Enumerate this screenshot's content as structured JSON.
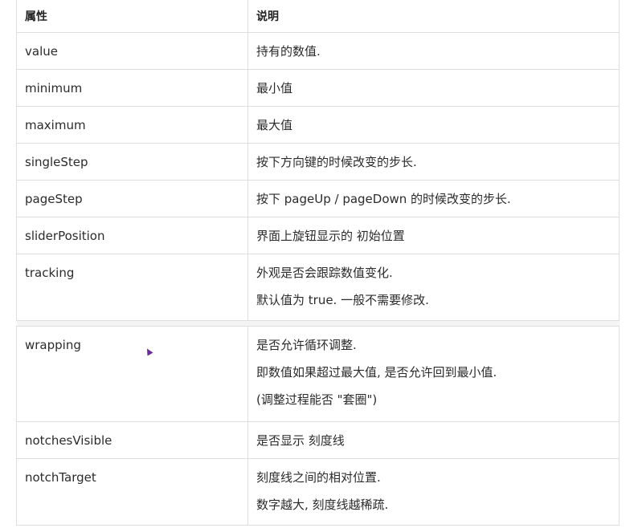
{
  "table": {
    "headers": [
      "属性",
      "说明"
    ],
    "rows": [
      {
        "property": "value",
        "description": [
          "持有的数值."
        ]
      },
      {
        "property": "minimum",
        "description": [
          "最小值"
        ]
      },
      {
        "property": "maximum",
        "description": [
          "最大值"
        ]
      },
      {
        "property": "singleStep",
        "description": [
          "按下方向键的时候改变的步长."
        ]
      },
      {
        "property": "pageStep",
        "description": [
          "按下 pageUp / pageDown 的时候改变的步长."
        ]
      },
      {
        "property": "sliderPosition",
        "description": [
          "界面上旋钮显示的 初始位置"
        ]
      },
      {
        "property": "tracking",
        "description": [
          "外观是否会跟踪数值变化.",
          "默认值为 true. 一般不需要修改."
        ]
      },
      {
        "property": "wrapping",
        "description": [
          "是否允许循环调整.",
          "即数值如果超过最大值, 是否允许回到最小值.",
          "(调整过程能否 \"套圈\")"
        ]
      },
      {
        "property": "notchesVisible",
        "description": [
          "是否显示 刻度线"
        ]
      },
      {
        "property": "notchTarget",
        "description": [
          "刻度线之间的相对位置.",
          "数字越大, 刻度线越稀疏."
        ]
      }
    ]
  },
  "colors": {
    "border": "#dedede",
    "text": "#2b2b2b",
    "cursor": "#6a2a9a"
  },
  "icons": [
    "mouse-cursor-icon"
  ]
}
